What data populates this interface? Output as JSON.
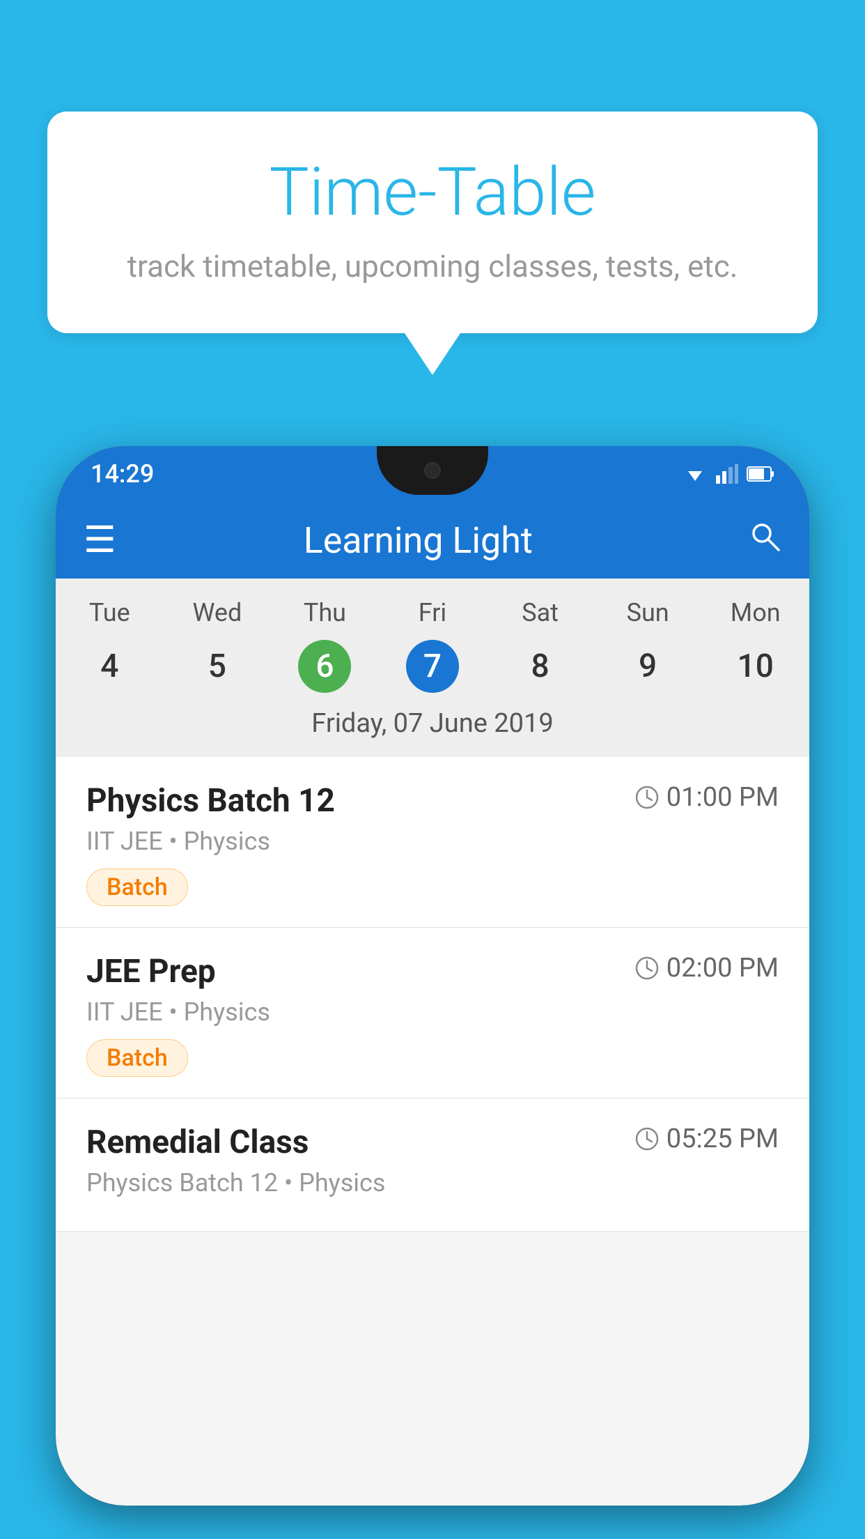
{
  "background_color": "#29b6e8",
  "speech_bubble": {
    "title": "Time-Table",
    "subtitle": "track timetable, upcoming classes, tests, etc."
  },
  "status_bar": {
    "time": "14:29"
  },
  "app_bar": {
    "title": "Learning Light"
  },
  "calendar": {
    "days": [
      {
        "label": "Tue",
        "number": "4"
      },
      {
        "label": "Wed",
        "number": "5"
      },
      {
        "label": "Thu",
        "number": "6",
        "state": "today"
      },
      {
        "label": "Fri",
        "number": "7",
        "state": "selected"
      },
      {
        "label": "Sat",
        "number": "8"
      },
      {
        "label": "Sun",
        "number": "9"
      },
      {
        "label": "Mon",
        "number": "10"
      }
    ],
    "selected_date_label": "Friday, 07 June 2019"
  },
  "schedule": {
    "items": [
      {
        "title": "Physics Batch 12",
        "time": "01:00 PM",
        "subtitle": "IIT JEE • Physics",
        "badge": "Batch"
      },
      {
        "title": "JEE Prep",
        "time": "02:00 PM",
        "subtitle": "IIT JEE • Physics",
        "badge": "Batch"
      },
      {
        "title": "Remedial Class",
        "time": "05:25 PM",
        "subtitle": "Physics Batch 12 • Physics",
        "badge": ""
      }
    ]
  },
  "icons": {
    "menu": "☰",
    "search": "🔍",
    "clock": "🕐"
  }
}
